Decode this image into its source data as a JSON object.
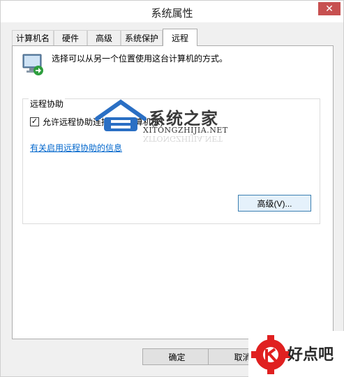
{
  "window": {
    "title": "系统属性",
    "close_glyph": "✕"
  },
  "tabs": [
    {
      "label": "计算机名",
      "active": false
    },
    {
      "label": "硬件",
      "active": false
    },
    {
      "label": "高级",
      "active": false
    },
    {
      "label": "系统保护",
      "active": false
    },
    {
      "label": "远程",
      "active": true
    }
  ],
  "remote": {
    "description": "选择可以从另一个位置使用这台计算机的方式。",
    "icon": "remote-monitor-icon",
    "assistance": {
      "group_title": "远程协助",
      "checkbox_label": "允许远程协助连接这台计算机(R)",
      "checkbox_checked": true,
      "info_link": "有关启用远程协助的信息",
      "advanced_button": "高级(V)..."
    }
  },
  "footer": {
    "ok_button": "确定",
    "cancel_button": "取消"
  },
  "watermarks": {
    "site1_title": "系统之家",
    "site1_url": "XITONGZHIJIA.NET",
    "site2_title": "好点吧"
  },
  "colors": {
    "accent": "#3c7fb1",
    "link": "#0066cc",
    "close": "#c75050"
  }
}
